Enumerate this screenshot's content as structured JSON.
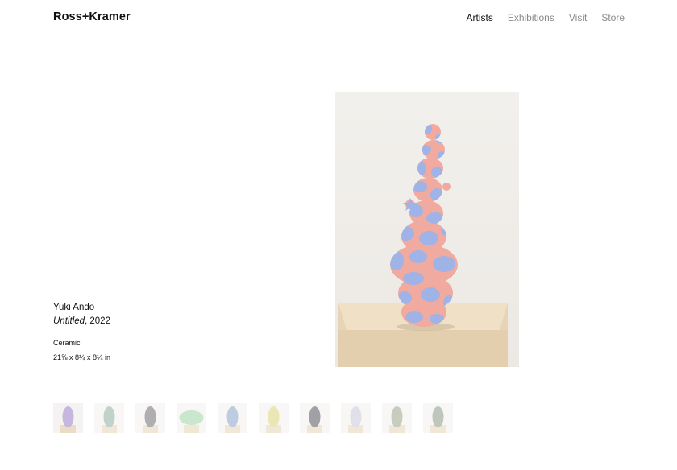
{
  "brand": {
    "logo": "Ross+Kramer"
  },
  "nav": {
    "items": [
      {
        "label": "Artists",
        "active": true
      },
      {
        "label": "Exhibitions",
        "active": false
      },
      {
        "label": "Visit",
        "active": false
      },
      {
        "label": "Store",
        "active": false
      }
    ]
  },
  "artwork": {
    "artist": "Yuki Ando",
    "title": "Untitled",
    "year_suffix": ", 2022",
    "medium": "Ceramic",
    "dimensions": "21⅝ x 8¼ x 8¼ in"
  },
  "thumbnails": [
    {
      "color": "#b9a6d6",
      "selected": true
    },
    {
      "color": "#8fae9e",
      "selected": false
    },
    {
      "color": "#6f6f73",
      "selected": false
    },
    {
      "color": "#9fd3a6",
      "selected": false
    },
    {
      "color": "#8aa3c9",
      "selected": false
    },
    {
      "color": "#d9d27a",
      "selected": false
    },
    {
      "color": "#55565c",
      "selected": false
    },
    {
      "color": "#c9c6d9",
      "selected": false
    },
    {
      "color": "#9aa38c",
      "selected": false
    },
    {
      "color": "#8c9b86",
      "selected": false
    }
  ],
  "colors": {
    "pink": "#f1aa9f",
    "blue": "#9fb3e6",
    "plinth": "#e7d4b7"
  }
}
